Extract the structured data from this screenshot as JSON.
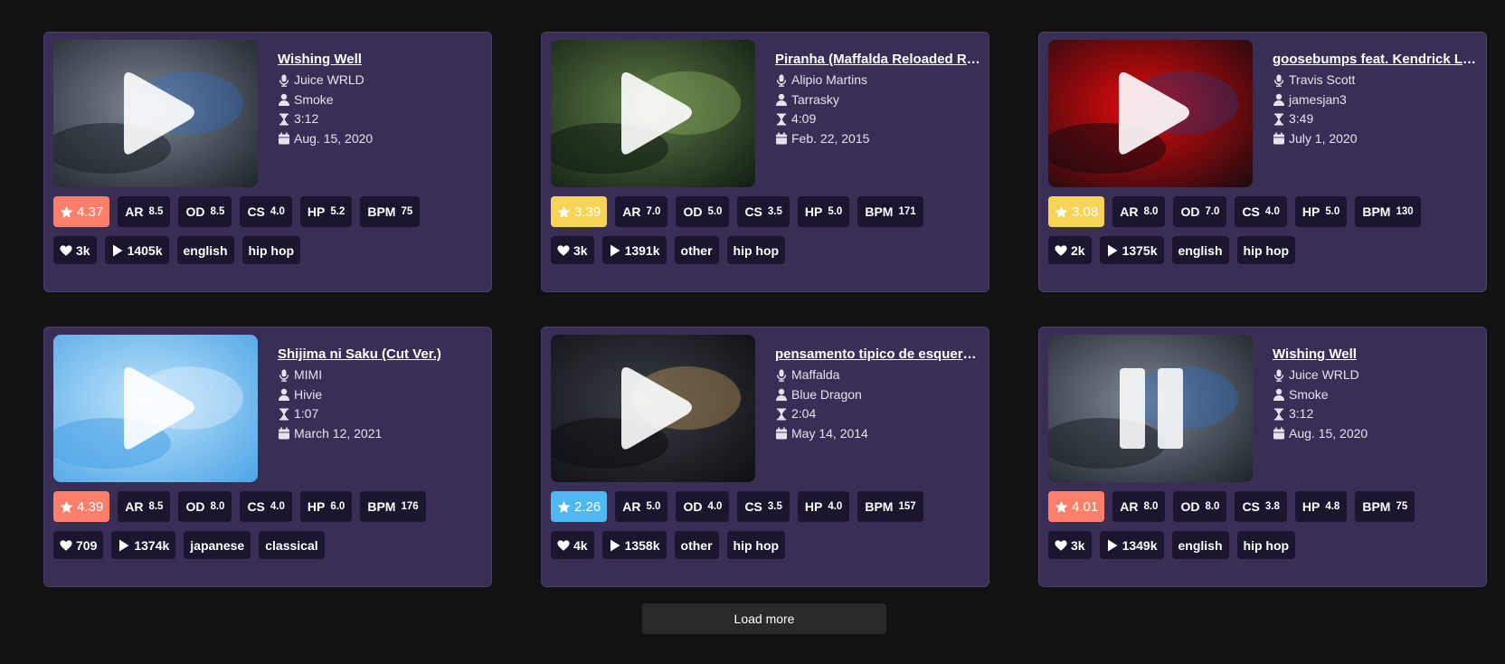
{
  "colors": {
    "page_bg": "#121214",
    "card_bg": "#392e55",
    "badge_bg": "#1b1530",
    "rating_red": "#ff7f6a",
    "rating_yellow": "#f8d456",
    "rating_blue": "#4fb8f3",
    "load_more_bg": "#2a2a2c"
  },
  "cards": [
    {
      "title": "Wishing Well",
      "artist": "Juice WRLD",
      "mapper": "Smoke",
      "duration": "3:12",
      "date": "Aug. 15, 2020",
      "rating": "4.37",
      "rating_color": "#ff7f6a",
      "ar": "8.5",
      "od": "8.5",
      "cs": "4.0",
      "hp": "5.2",
      "bpm": "75",
      "likes": "3k",
      "plays": "1405k",
      "language": "english",
      "genre": "hip hop",
      "player_state": "play",
      "art": {
        "a": "#7d8793",
        "b": "#1c2128",
        "c": "#2f6fcf"
      }
    },
    {
      "title": "Piranha (Maffalda Reloaded Remix)",
      "artist": "Alipio Martins",
      "mapper": "Tarrasky",
      "duration": "4:09",
      "date": "Feb. 22, 2015",
      "rating": "3.39",
      "rating_color": "#f8d456",
      "ar": "7.0",
      "od": "5.0",
      "cs": "3.5",
      "hp": "5.0",
      "bpm": "171",
      "likes": "3k",
      "plays": "1391k",
      "language": "other",
      "genre": "hip hop",
      "player_state": "play",
      "art": {
        "a": "#5e7a45",
        "b": "#0f1a12",
        "c": "#9fbf6a"
      }
    },
    {
      "title": "goosebumps feat. Kendrick Lamar",
      "artist": "Travis Scott",
      "mapper": "jamesjan3",
      "duration": "3:49",
      "date": "July 1, 2020",
      "rating": "3.08",
      "rating_color": "#f8d456",
      "ar": "8.0",
      "od": "7.0",
      "cs": "4.0",
      "hp": "5.0",
      "bpm": "130",
      "likes": "2k",
      "plays": "1375k",
      "language": "english",
      "genre": "hip hop",
      "player_state": "play",
      "art": {
        "a": "#e40a0a",
        "b": "#140a10",
        "c": "#1c3c8c"
      }
    },
    {
      "title": "Shijima ni Saku (Cut Ver.)",
      "artist": "MIMI",
      "mapper": "Hivie",
      "duration": "1:07",
      "date": "March 12, 2021",
      "rating": "4.39",
      "rating_color": "#ff7f6a",
      "ar": "8.5",
      "od": "8.0",
      "cs": "4.0",
      "hp": "6.0",
      "bpm": "176",
      "likes": "709",
      "plays": "1374k",
      "language": "japanese",
      "genre": "classical",
      "player_state": "play",
      "art": {
        "a": "#bfe4fb",
        "b": "#4aa3e6",
        "c": "#f4f8ff"
      }
    },
    {
      "title": "pensamento tipico de esquerda caviar",
      "artist": "Maffalda",
      "mapper": "Blue Dragon",
      "duration": "2:04",
      "date": "May 14, 2014",
      "rating": "2.26",
      "rating_color": "#4fb8f3",
      "ar": "5.0",
      "od": "4.0",
      "cs": "3.5",
      "hp": "4.0",
      "bpm": "157",
      "likes": "4k",
      "plays": "1358k",
      "language": "other",
      "genre": "hip hop",
      "player_state": "play",
      "art": {
        "a": "#3a3d45",
        "b": "#0c0d12",
        "c": "#e0b060"
      }
    },
    {
      "title": "Wishing Well",
      "artist": "Juice WRLD",
      "mapper": "Smoke",
      "duration": "3:12",
      "date": "Aug. 15, 2020",
      "rating": "4.01",
      "rating_color": "#ff7f6a",
      "ar": "8.0",
      "od": "8.0",
      "cs": "3.8",
      "hp": "4.8",
      "bpm": "75",
      "likes": "3k",
      "plays": "1349k",
      "language": "english",
      "genre": "hip hop",
      "player_state": "pause",
      "art": {
        "a": "#7d8793",
        "b": "#1c2128",
        "c": "#2f6fcf"
      }
    }
  ],
  "labels": {
    "ar": "AR",
    "od": "OD",
    "cs": "CS",
    "hp": "HP",
    "bpm": "BPM"
  },
  "load_more_label": "Load more"
}
